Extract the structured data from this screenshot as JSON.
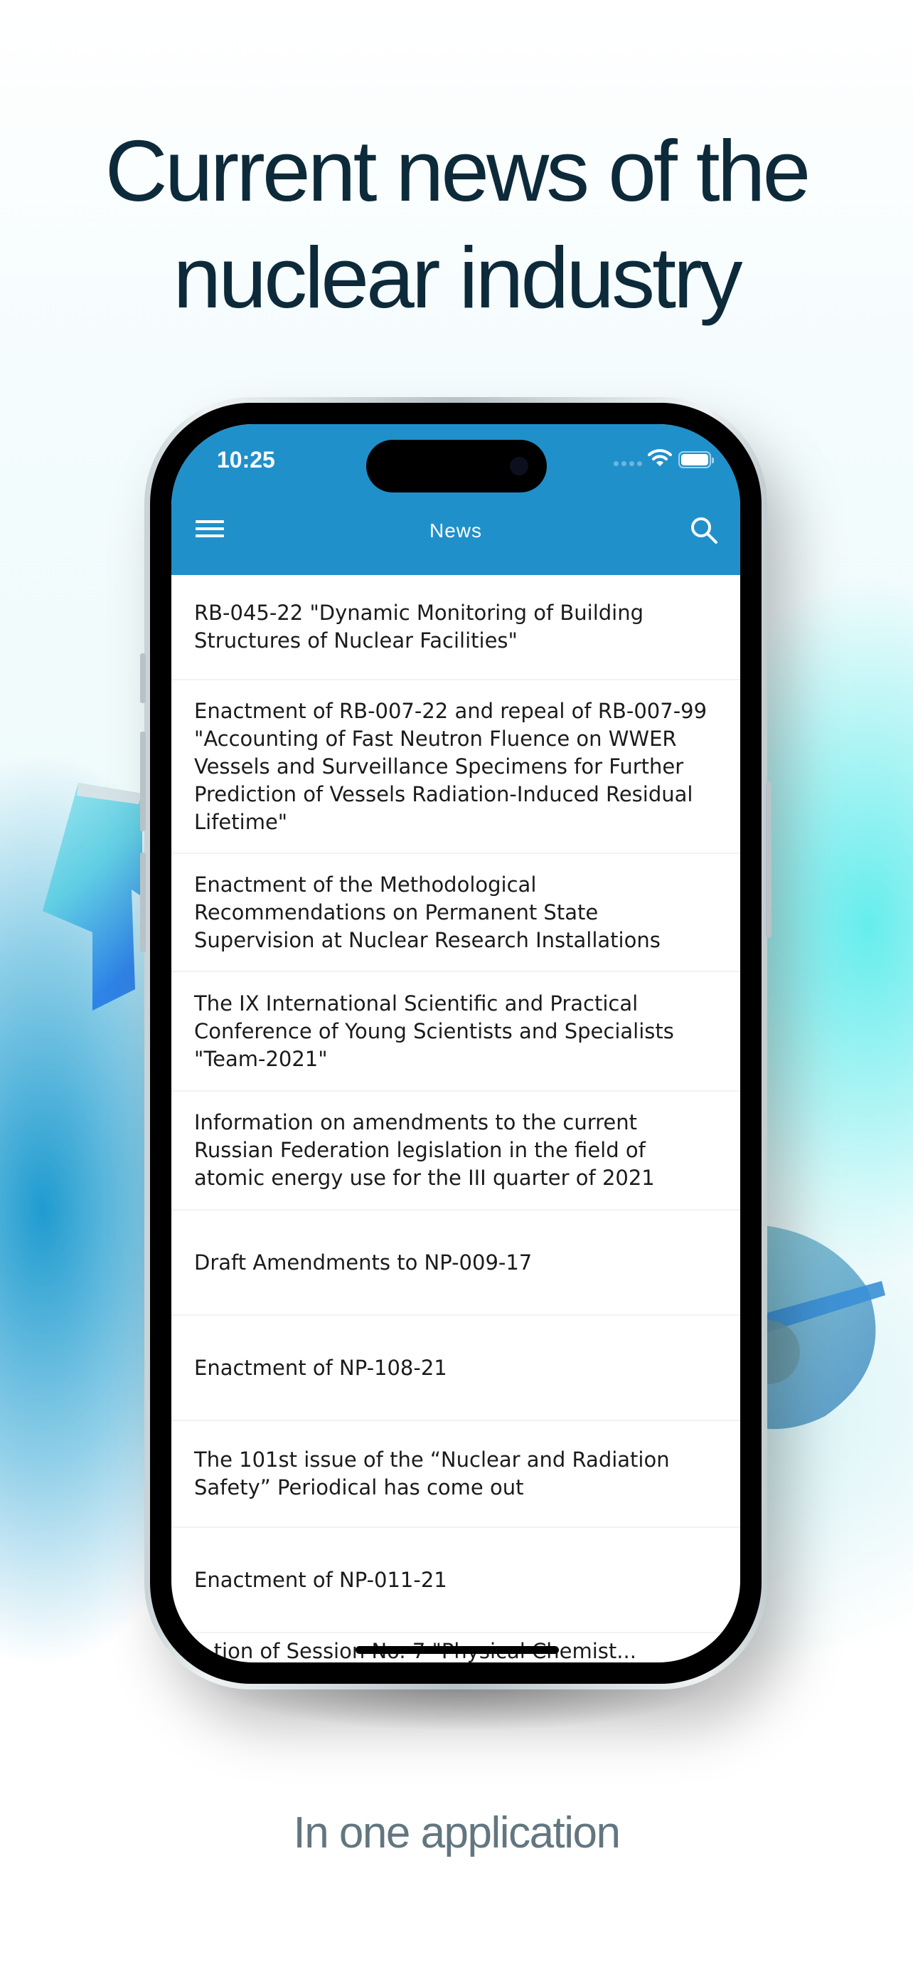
{
  "promo": {
    "headline": "Current news of the nuclear industry",
    "subline": "In one application"
  },
  "colors": {
    "appbar": "#2090cb",
    "headline": "#0d2a3a",
    "subline": "#627680"
  },
  "status_bar": {
    "time": "10:25",
    "icons": [
      "signal-icon",
      "wifi-icon",
      "battery-icon"
    ]
  },
  "app_bar": {
    "menu_icon": "hamburger-menu-icon",
    "title": "News",
    "search_icon": "search-icon"
  },
  "news": [
    {
      "title": "RB-045-22 \"Dynamic Monitoring of Building Structures of Nuclear Facilities\""
    },
    {
      "title": "Enactment of RB-007-22 and repeal of RB-007-99 \"Accounting of Fast Neutron Fluence on WWER Vessels and Surveillance Specimens for Further Prediction of Vessels Radiation-Induced Residual Lifetime\""
    },
    {
      "title": "Enactment of the Methodological Recommendations on Permanent State Supervision at Nuclear Research Installations"
    },
    {
      "title": "The IX International Scientific and Practical Conference of Young Scientists and Specialists \"Team-2021\""
    },
    {
      "title": "Information on amendments to the current Russian Federation legislation in the field of atomic energy use for the III quarter of 2021"
    },
    {
      "title": "Draft Amendments to NP-009-17"
    },
    {
      "title": "Enactment of NP-108-21"
    },
    {
      "title": "The 101st issue of the “Nuclear and Radiation Safety” Periodical has come out"
    },
    {
      "title": "Enactment of NP-011-21"
    },
    {
      "title": "...tion of Session No. 7 \"Physical Chemist..."
    }
  ]
}
